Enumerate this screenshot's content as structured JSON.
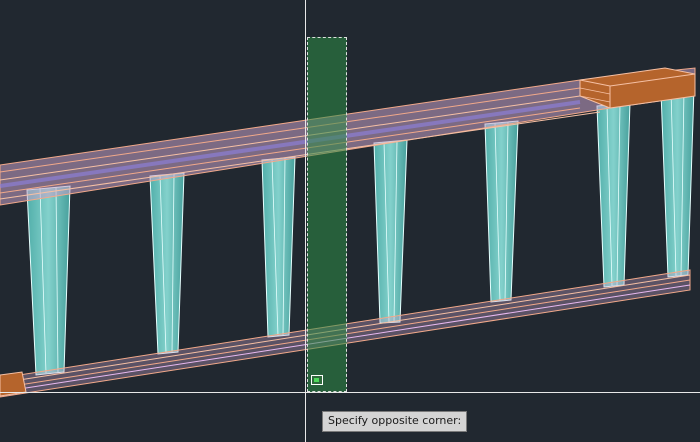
{
  "prompt": {
    "tooltip_text": "Specify opposite corner:"
  },
  "colors": {
    "background": "#212830",
    "beam_outline": "#f2a98a",
    "beam_fill": "#c9a0c8",
    "post_fill": "#6fd6cf",
    "post_outline": "#e6fffe",
    "end_cap": "#b5642c",
    "selection_window": "#2e8c46",
    "crosshair": "#e8e8e8"
  }
}
